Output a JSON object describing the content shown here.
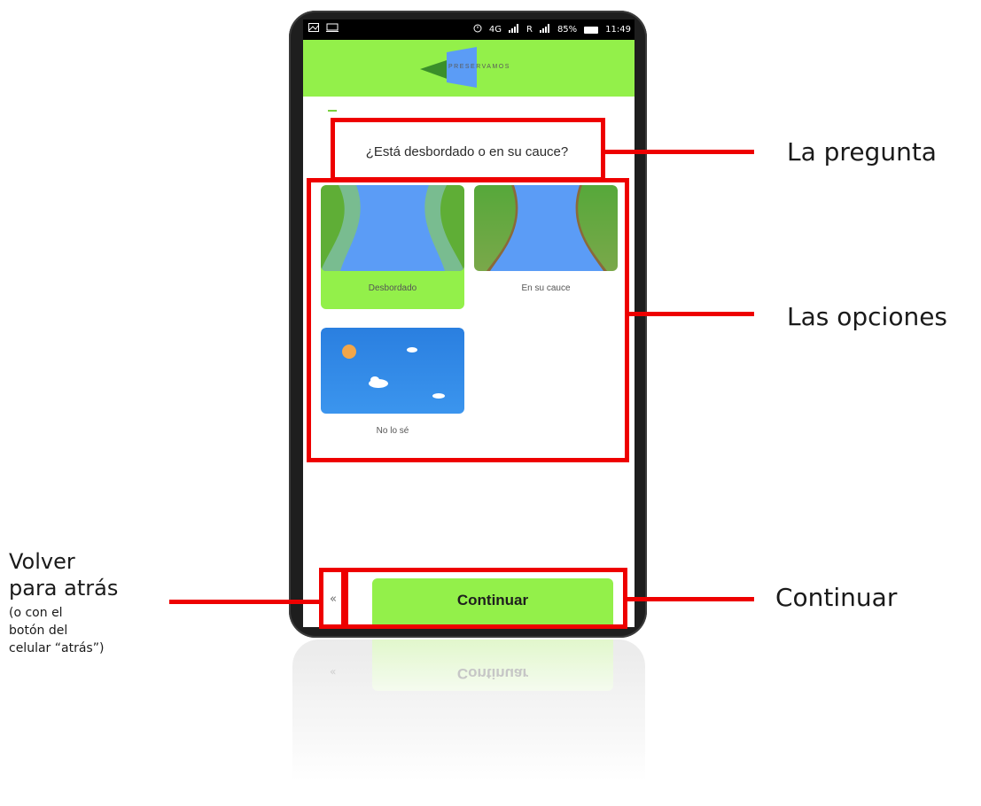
{
  "status_bar": {
    "left_icons": [
      "image-icon",
      "screen-icon"
    ],
    "network": "4G",
    "carrier_indicator": "R",
    "battery": "85%",
    "time": "11:49"
  },
  "app": {
    "brand": "PRESERVAMOS",
    "question": "¿Está desbordado o en su cauce?",
    "options": [
      {
        "label": "Desbordado",
        "selected": true,
        "image": "overflowing-river-illustration"
      },
      {
        "label": "En su cauce",
        "selected": false,
        "image": "river-in-channel-illustration"
      },
      {
        "label": "No lo sé",
        "selected": false,
        "image": "sky-clouds-illustration"
      }
    ],
    "back_label": "«",
    "continue_label": "Continuar"
  },
  "annotations": {
    "question_label": "La pregunta",
    "options_label": "Las opciones",
    "continue_label": "Continuar",
    "back_title_line1": "Volver",
    "back_title_line2": "para atrás",
    "back_note_line1": "(o con el",
    "back_note_line2": "botón del",
    "back_note_line3": "celular “atrás”)"
  },
  "colors": {
    "accent_green": "#93f04a",
    "annotation_red": "#ee0000",
    "river_blue": "#5b9cf6",
    "bank_green": "#5fae36",
    "sky_blue": "#2f8ae8",
    "sun_orange": "#f2a64a"
  }
}
